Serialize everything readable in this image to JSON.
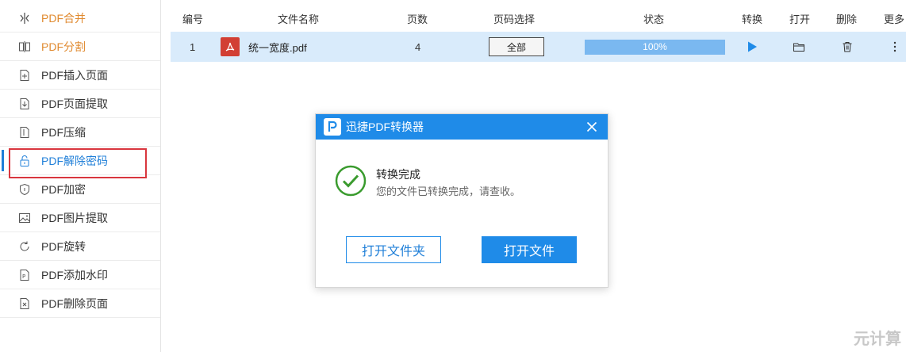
{
  "sidebar": {
    "items": [
      {
        "label": "PDF合并",
        "icon": "merge-icon"
      },
      {
        "label": "PDF分割",
        "icon": "split-icon"
      },
      {
        "label": "PDF插入页面",
        "icon": "insert-page-icon"
      },
      {
        "label": "PDF页面提取",
        "icon": "extract-page-icon"
      },
      {
        "label": "PDF压缩",
        "icon": "compress-icon"
      },
      {
        "label": "PDF解除密码",
        "icon": "unlock-icon"
      },
      {
        "label": "PDF加密",
        "icon": "shield-icon"
      },
      {
        "label": "PDF图片提取",
        "icon": "image-icon"
      },
      {
        "label": "PDF旋转",
        "icon": "rotate-icon"
      },
      {
        "label": "PDF添加水印",
        "icon": "watermark-icon"
      },
      {
        "label": "PDF删除页面",
        "icon": "delete-page-icon"
      }
    ],
    "active_index": 5
  },
  "table": {
    "headers": {
      "index": "编号",
      "filename": "文件名称",
      "pages": "页数",
      "page_select": "页码选择",
      "status": "状态",
      "convert": "转换",
      "open": "打开",
      "delete": "删除",
      "more": "更多"
    },
    "rows": [
      {
        "index": "1",
        "filename": "统一宽度.pdf",
        "pages": "4",
        "range": "全部",
        "progress_text": "100%",
        "progress_fraction": 1.0
      }
    ]
  },
  "dialog": {
    "title": "迅捷PDF转换器",
    "message_title": "转换完成",
    "message_sub": "您的文件已转换完成，请查收。",
    "btn_open_folder": "打开文件夹",
    "btn_open_file": "打开文件"
  },
  "watermark": "元计算",
  "colors": {
    "accent": "#1f8be8",
    "active_text": "#1f7fd8",
    "orange_text": "#e08a2f",
    "row_bg": "#d9ebfb",
    "success": "#3a9b2e",
    "highlight": "#d9363e"
  }
}
